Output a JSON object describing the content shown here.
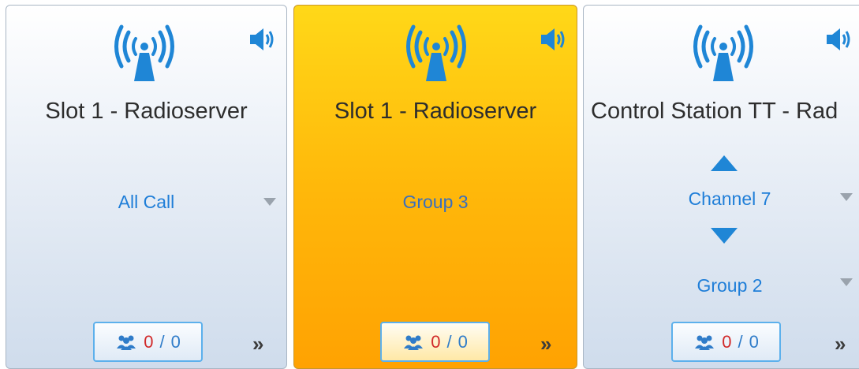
{
  "tiles": [
    {
      "title": "Slot 1 - Radioserver",
      "selection": "All Call",
      "counter": {
        "active": "0",
        "separator": "/",
        "total": "0"
      },
      "more_glyph": "»"
    },
    {
      "title": "Slot 1 - Radioserver",
      "selection": "Group 3",
      "counter": {
        "active": "0",
        "separator": "/",
        "total": "0"
      },
      "more_glyph": "»"
    },
    {
      "title": "Control Station TT - Rad",
      "channel": "Channel 7",
      "selection": "Group 2",
      "counter": {
        "active": "0",
        "separator": "/",
        "total": "0"
      },
      "more_glyph": "»"
    }
  ],
  "colors": {
    "accent_blue": "#1f86d6",
    "tile_blue_bg": "#dfe8f3",
    "tile_selected_bg": "#ffb80a",
    "count_active": "#d12a2a"
  },
  "icons": [
    "antenna-icon",
    "speaker-icon",
    "users-icon",
    "double-chevron-right-icon",
    "dropdown-arrow-icon",
    "channel-up-icon",
    "channel-down-icon"
  ]
}
